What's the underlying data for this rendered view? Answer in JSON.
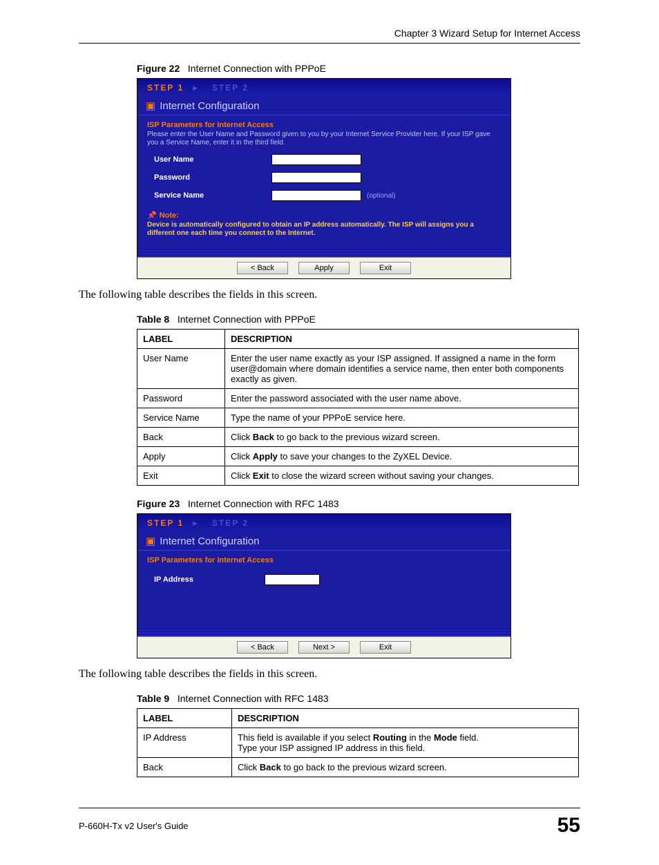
{
  "header": {
    "chapter": "Chapter 3 Wizard Setup for Internet Access"
  },
  "fig22": {
    "label": "Figure 22",
    "title": "Internet Connection with PPPoE"
  },
  "wiz1": {
    "step1": "STEP 1",
    "step2": "STEP 2",
    "title": "Internet Configuration",
    "isp_h": "ISP Parameters for Internet Access",
    "isp_p": "Please enter the User Name and Password given to you by your Internet Service Provider here. If your ISP gave you a Service Name, enter it in the third field.",
    "lbl_user": "User Name",
    "lbl_pass": "Password",
    "lbl_svc": "Service Name",
    "optional": "(optional)",
    "note_h": "Note:",
    "note_p": "Device is automatically configured to obtain an IP address automatically. The ISP will assigns you a different one each time you connect to the Internet.",
    "btn_back": "< Back",
    "btn_apply": "Apply",
    "btn_exit": "Exit"
  },
  "para1": "The following table describes the fields in this screen.",
  "table8": {
    "label": "Table 8",
    "title": "Internet Connection with PPPoE",
    "h1": "LABEL",
    "h2": "DESCRIPTION",
    "rows": [
      {
        "l": "User Name",
        "d_pre": "Enter the user name exactly as your ISP assigned. If assigned a name in the form user@domain where domain identifies a service name, then enter both components exactly as given."
      },
      {
        "l": "Password",
        "d_pre": "Enter the password associated with the user name above."
      },
      {
        "l": "Service Name",
        "d_pre": "Type the name of your PPPoE service here."
      },
      {
        "l": "Back",
        "d_pre": "Click ",
        "d_b": "Back",
        "d_post": " to go back to the previous wizard screen."
      },
      {
        "l": "Apply",
        "d_pre": "Click ",
        "d_b": "Apply",
        "d_post": " to save your changes to the ZyXEL Device."
      },
      {
        "l": "Exit",
        "d_pre": "Click ",
        "d_b": "Exit",
        "d_post": " to close the wizard screen without saving your changes."
      }
    ]
  },
  "fig23": {
    "label": "Figure 23",
    "title": "Internet Connection with RFC 1483"
  },
  "wiz2": {
    "step1": "STEP 1",
    "step2": "STEP 2",
    "title": "Internet Configuration",
    "isp_h": "ISP Parameters for Internet Access",
    "lbl_ip": "IP Address",
    "btn_back": "< Back",
    "btn_next": "Next >",
    "btn_exit": "Exit"
  },
  "para2": "The following table describes the fields in this screen.",
  "table9": {
    "label": "Table 9",
    "title": "Internet Connection with RFC 1483",
    "h1": "LABEL",
    "h2": "DESCRIPTION",
    "rows": [
      {
        "l": "IP Address",
        "d_pre": "This field is available if you select ",
        "d_b": "Routing",
        "d_mid": " in the ",
        "d_b2": "Mode",
        "d_post": " field.\nType your ISP assigned IP address in this field."
      },
      {
        "l": "Back",
        "d_pre": "Click ",
        "d_b": "Back",
        "d_post": " to go back to the previous wizard screen."
      }
    ]
  },
  "footer": {
    "guide": "P-660H-Tx v2 User's Guide",
    "page": "55"
  }
}
